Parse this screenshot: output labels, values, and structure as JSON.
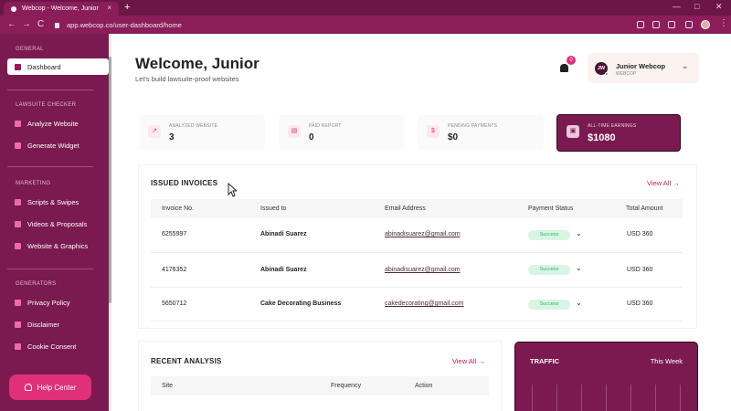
{
  "browser": {
    "tab_title": "Webcop - Welcome, Junior",
    "tab_close": "×",
    "new_tab": "+",
    "url": "app.webcop.co/user-dashboard/home",
    "back": "←",
    "forward": "→",
    "reload": "C",
    "minimize": "—",
    "maximize": "□",
    "close": "✕",
    "kebab": "⋮"
  },
  "sidebar": {
    "sections": [
      {
        "title": "GENERAL",
        "items": [
          {
            "label": "Dashboard",
            "active": true
          }
        ]
      },
      {
        "title": "LAWSUITE CHECKER",
        "items": [
          {
            "label": "Analyze Website"
          },
          {
            "label": "Generate Widget"
          }
        ]
      },
      {
        "title": "MARKETING",
        "items": [
          {
            "label": "Scripts & Swipes"
          },
          {
            "label": "Videos & Proposals"
          },
          {
            "label": "Website & Graphics"
          }
        ]
      },
      {
        "title": "GENERATORS",
        "items": [
          {
            "label": "Privacy Policy"
          },
          {
            "label": "Disclaimer"
          },
          {
            "label": "Cookie Consent"
          }
        ]
      }
    ],
    "help": "Help Center"
  },
  "header": {
    "title": "Welcome, Junior",
    "subtitle": "Let's build lawsuite-proof websites",
    "notifications": "0",
    "user": {
      "initials": "JW",
      "name": "Junior Webcop",
      "org": "WEBCOP",
      "chevron": "⌄"
    }
  },
  "stats": [
    {
      "label": "ANALYZED WEBSITE",
      "value": "3",
      "icon": "chart-icon"
    },
    {
      "label": "PAID REPORT",
      "value": "0",
      "icon": "report-icon"
    },
    {
      "label": "PENDING PAYMENTS",
      "value": "$0",
      "icon": "dollar-icon"
    },
    {
      "label": "ALL-TIME EARNINGS",
      "value": "$1080",
      "icon": "wallet-icon"
    }
  ],
  "invoices": {
    "title": "ISSUED INVOICES",
    "view_all": "View All →",
    "columns": [
      "Invoice No.",
      "Issued to",
      "Email Address",
      "Payment Status",
      "Total Amount"
    ],
    "rows": [
      {
        "no": "6255997",
        "to": "Abinadi Suarez",
        "email": "abinadisuarez@gmail.com",
        "status": "Success",
        "amount": "USD 360"
      },
      {
        "no": "4176352",
        "to": "Abinadi Suarez",
        "email": "abinadisuarez@gmail.com",
        "status": "Success",
        "amount": "USD 360"
      },
      {
        "no": "5650712",
        "to": "Cake Decorating Business",
        "email": "cakedecorating@gmail.com",
        "status": "Success",
        "amount": "USD 360"
      }
    ]
  },
  "analysis": {
    "title": "RECENT ANALYSIS",
    "view_all": "View All →",
    "columns": [
      "Site",
      "Frequency",
      "Action"
    ]
  },
  "traffic": {
    "title": "TRAFFIC",
    "period": "This Week"
  },
  "colors": {
    "brand": "#7a1a50",
    "accent": "#e0307a",
    "success_bg": "#d8f5e3",
    "success_text": "#2fb56d"
  }
}
